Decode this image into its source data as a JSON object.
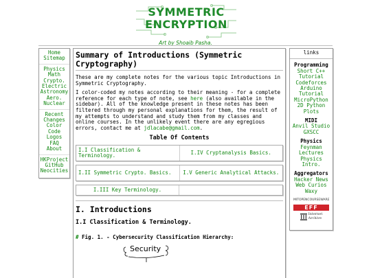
{
  "banner": {
    "title_line1": "SYMMETRIC",
    "title_line2": "ENCRYPTION",
    "credit": "Art by Shoaib Pasha."
  },
  "left_nav": {
    "group1": [
      "Home",
      "Sitemap"
    ],
    "group2": [
      "Physics",
      "Math",
      "Crypto.",
      "Electric",
      "Astronomy",
      "Aero.",
      "Nuclear"
    ],
    "group3": [
      "Recent",
      "Changes",
      "Color",
      "Code",
      "Logos",
      "FAQ",
      "About"
    ],
    "group4": [
      "HKProject",
      "GitHub",
      "Neocities"
    ]
  },
  "main": {
    "title": "Summary of Introductions (Symmetric Cryptography)",
    "intro": "These are my complete notes for the various topic Introductions in Symmetric Cryptography.",
    "color_note_before": "I color-coded my notes according to their meaning - for a complete reference for each type of note, see ",
    "color_note_link": "here",
    "color_note_after": " (also available in the sidebar). All of the knowledge present in these notes has been filtered through my personal explanations for them, the result of my attempts to understand and study them from my classes and online courses. In the unlikely event there are any egregious errors, contact me at ",
    "email": "jdlacabe@gmail.com",
    "email_after": ".",
    "toc_title": "Table Of Contents",
    "toc": {
      "r1c1": "I.I Classification & Terminology.",
      "r1c2": "I.IV Cryptanalysis Basics.",
      "r2c1": "I.II Symmetric Crypto. Basics.",
      "r2c2": "I.V Generic Analytical Attacks.",
      "r3c1": "I.III Key Terminology."
    },
    "section_heading": "I. Introductions",
    "subsection_heading": "I.I Classification & Terminology.",
    "figure_hash": "#",
    "figure_caption": "Fig. 1. - Cybersecurity Classification Hierarchy:",
    "figure_word": "Security"
  },
  "right_nav": {
    "header": "links",
    "programming_h": "Programming",
    "programming": [
      "Short C++",
      "Tutorial",
      "Codeforces",
      "Arduino",
      "Tutorial",
      "MicroPython",
      "2D Python",
      "Plots"
    ],
    "midi_h": "MIDI",
    "midi": [
      "Anvil Studio",
      "GXSCC"
    ],
    "physics_h": "Physics",
    "physics": [
      "Feynman",
      "Lectures",
      "Physics",
      "Intro."
    ],
    "aggregators_h": "Aggregators",
    "aggregators": [
      "Hacker News",
      "Web Curios",
      "Waxy"
    ],
    "badge_mit": "MITOPENCOURSEWARE",
    "badge_eff": "EFF",
    "badge_ia_1": "Internet",
    "badge_ia_2": "Archive"
  }
}
